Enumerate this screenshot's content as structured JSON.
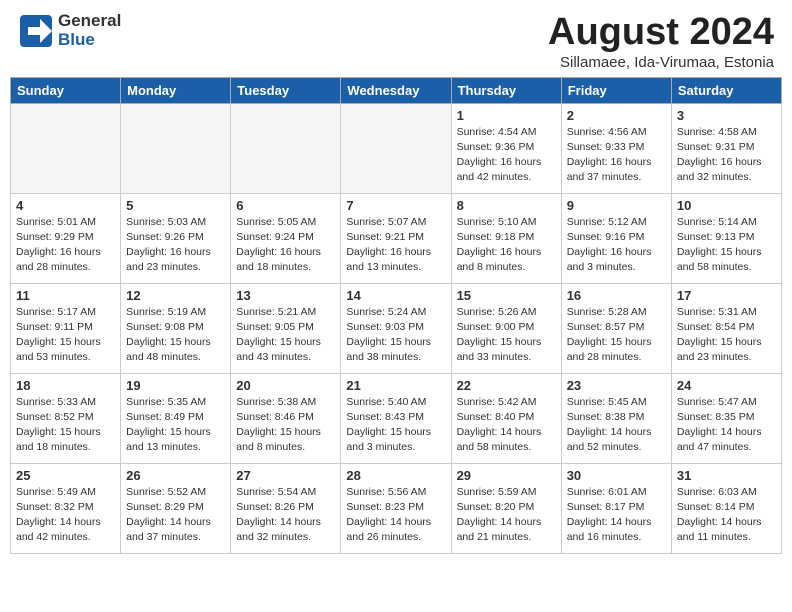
{
  "header": {
    "logo_general": "General",
    "logo_blue": "Blue",
    "month_year": "August 2024",
    "location": "Sillamaee, Ida-Virumaa, Estonia"
  },
  "weekdays": [
    "Sunday",
    "Monday",
    "Tuesday",
    "Wednesday",
    "Thursday",
    "Friday",
    "Saturday"
  ],
  "weeks": [
    [
      {
        "day": "",
        "empty": true
      },
      {
        "day": "",
        "empty": true
      },
      {
        "day": "",
        "empty": true
      },
      {
        "day": "",
        "empty": true
      },
      {
        "day": "1",
        "sunrise": "Sunrise: 4:54 AM",
        "sunset": "Sunset: 9:36 PM",
        "daylight": "Daylight: 16 hours and 42 minutes."
      },
      {
        "day": "2",
        "sunrise": "Sunrise: 4:56 AM",
        "sunset": "Sunset: 9:33 PM",
        "daylight": "Daylight: 16 hours and 37 minutes."
      },
      {
        "day": "3",
        "sunrise": "Sunrise: 4:58 AM",
        "sunset": "Sunset: 9:31 PM",
        "daylight": "Daylight: 16 hours and 32 minutes."
      }
    ],
    [
      {
        "day": "4",
        "sunrise": "Sunrise: 5:01 AM",
        "sunset": "Sunset: 9:29 PM",
        "daylight": "Daylight: 16 hours and 28 minutes."
      },
      {
        "day": "5",
        "sunrise": "Sunrise: 5:03 AM",
        "sunset": "Sunset: 9:26 PM",
        "daylight": "Daylight: 16 hours and 23 minutes."
      },
      {
        "day": "6",
        "sunrise": "Sunrise: 5:05 AM",
        "sunset": "Sunset: 9:24 PM",
        "daylight": "Daylight: 16 hours and 18 minutes."
      },
      {
        "day": "7",
        "sunrise": "Sunrise: 5:07 AM",
        "sunset": "Sunset: 9:21 PM",
        "daylight": "Daylight: 16 hours and 13 minutes."
      },
      {
        "day": "8",
        "sunrise": "Sunrise: 5:10 AM",
        "sunset": "Sunset: 9:18 PM",
        "daylight": "Daylight: 16 hours and 8 minutes."
      },
      {
        "day": "9",
        "sunrise": "Sunrise: 5:12 AM",
        "sunset": "Sunset: 9:16 PM",
        "daylight": "Daylight: 16 hours and 3 minutes."
      },
      {
        "day": "10",
        "sunrise": "Sunrise: 5:14 AM",
        "sunset": "Sunset: 9:13 PM",
        "daylight": "Daylight: 15 hours and 58 minutes."
      }
    ],
    [
      {
        "day": "11",
        "sunrise": "Sunrise: 5:17 AM",
        "sunset": "Sunset: 9:11 PM",
        "daylight": "Daylight: 15 hours and 53 minutes."
      },
      {
        "day": "12",
        "sunrise": "Sunrise: 5:19 AM",
        "sunset": "Sunset: 9:08 PM",
        "daylight": "Daylight: 15 hours and 48 minutes."
      },
      {
        "day": "13",
        "sunrise": "Sunrise: 5:21 AM",
        "sunset": "Sunset: 9:05 PM",
        "daylight": "Daylight: 15 hours and 43 minutes."
      },
      {
        "day": "14",
        "sunrise": "Sunrise: 5:24 AM",
        "sunset": "Sunset: 9:03 PM",
        "daylight": "Daylight: 15 hours and 38 minutes."
      },
      {
        "day": "15",
        "sunrise": "Sunrise: 5:26 AM",
        "sunset": "Sunset: 9:00 PM",
        "daylight": "Daylight: 15 hours and 33 minutes."
      },
      {
        "day": "16",
        "sunrise": "Sunrise: 5:28 AM",
        "sunset": "Sunset: 8:57 PM",
        "daylight": "Daylight: 15 hours and 28 minutes."
      },
      {
        "day": "17",
        "sunrise": "Sunrise: 5:31 AM",
        "sunset": "Sunset: 8:54 PM",
        "daylight": "Daylight: 15 hours and 23 minutes."
      }
    ],
    [
      {
        "day": "18",
        "sunrise": "Sunrise: 5:33 AM",
        "sunset": "Sunset: 8:52 PM",
        "daylight": "Daylight: 15 hours and 18 minutes."
      },
      {
        "day": "19",
        "sunrise": "Sunrise: 5:35 AM",
        "sunset": "Sunset: 8:49 PM",
        "daylight": "Daylight: 15 hours and 13 minutes."
      },
      {
        "day": "20",
        "sunrise": "Sunrise: 5:38 AM",
        "sunset": "Sunset: 8:46 PM",
        "daylight": "Daylight: 15 hours and 8 minutes."
      },
      {
        "day": "21",
        "sunrise": "Sunrise: 5:40 AM",
        "sunset": "Sunset: 8:43 PM",
        "daylight": "Daylight: 15 hours and 3 minutes."
      },
      {
        "day": "22",
        "sunrise": "Sunrise: 5:42 AM",
        "sunset": "Sunset: 8:40 PM",
        "daylight": "Daylight: 14 hours and 58 minutes."
      },
      {
        "day": "23",
        "sunrise": "Sunrise: 5:45 AM",
        "sunset": "Sunset: 8:38 PM",
        "daylight": "Daylight: 14 hours and 52 minutes."
      },
      {
        "day": "24",
        "sunrise": "Sunrise: 5:47 AM",
        "sunset": "Sunset: 8:35 PM",
        "daylight": "Daylight: 14 hours and 47 minutes."
      }
    ],
    [
      {
        "day": "25",
        "sunrise": "Sunrise: 5:49 AM",
        "sunset": "Sunset: 8:32 PM",
        "daylight": "Daylight: 14 hours and 42 minutes."
      },
      {
        "day": "26",
        "sunrise": "Sunrise: 5:52 AM",
        "sunset": "Sunset: 8:29 PM",
        "daylight": "Daylight: 14 hours and 37 minutes."
      },
      {
        "day": "27",
        "sunrise": "Sunrise: 5:54 AM",
        "sunset": "Sunset: 8:26 PM",
        "daylight": "Daylight: 14 hours and 32 minutes."
      },
      {
        "day": "28",
        "sunrise": "Sunrise: 5:56 AM",
        "sunset": "Sunset: 8:23 PM",
        "daylight": "Daylight: 14 hours and 26 minutes."
      },
      {
        "day": "29",
        "sunrise": "Sunrise: 5:59 AM",
        "sunset": "Sunset: 8:20 PM",
        "daylight": "Daylight: 14 hours and 21 minutes."
      },
      {
        "day": "30",
        "sunrise": "Sunrise: 6:01 AM",
        "sunset": "Sunset: 8:17 PM",
        "daylight": "Daylight: 14 hours and 16 minutes."
      },
      {
        "day": "31",
        "sunrise": "Sunrise: 6:03 AM",
        "sunset": "Sunset: 8:14 PM",
        "daylight": "Daylight: 14 hours and 11 minutes."
      }
    ]
  ]
}
